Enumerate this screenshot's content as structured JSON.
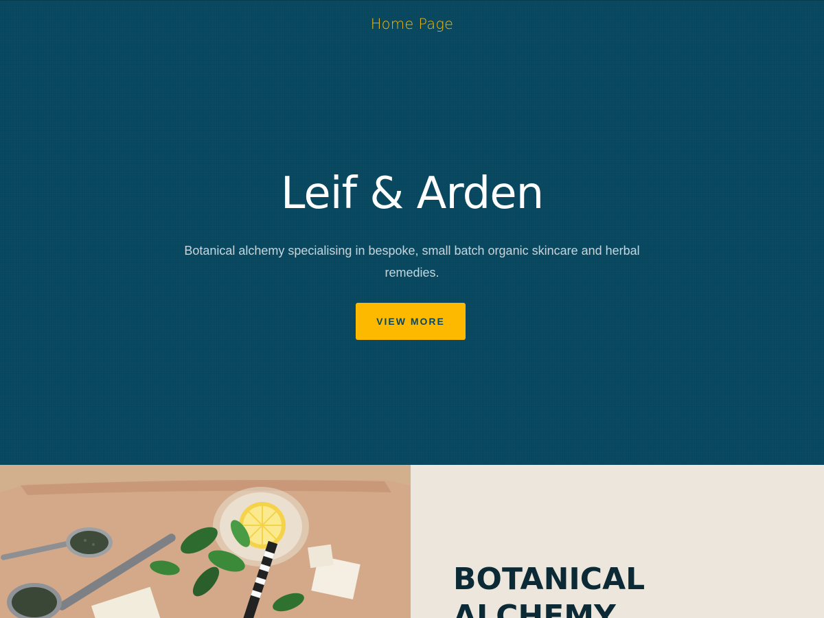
{
  "nav": {
    "home_label": "Home Page"
  },
  "hero": {
    "title": "Leif & Arden",
    "description": "Botanical alchemy specialising in bespoke, small batch organic skincare and herbal remedies.",
    "cta_label": "VIEW MORE"
  },
  "feature": {
    "heading": "BOTANICAL ALCHEMY",
    "image_icon": "herbal-ingredients-photo"
  },
  "colors": {
    "hero_bg": "#07475f",
    "accent": "#fdb900",
    "feature_bg": "#ece6dc",
    "heading_dark": "#0b2a36"
  }
}
